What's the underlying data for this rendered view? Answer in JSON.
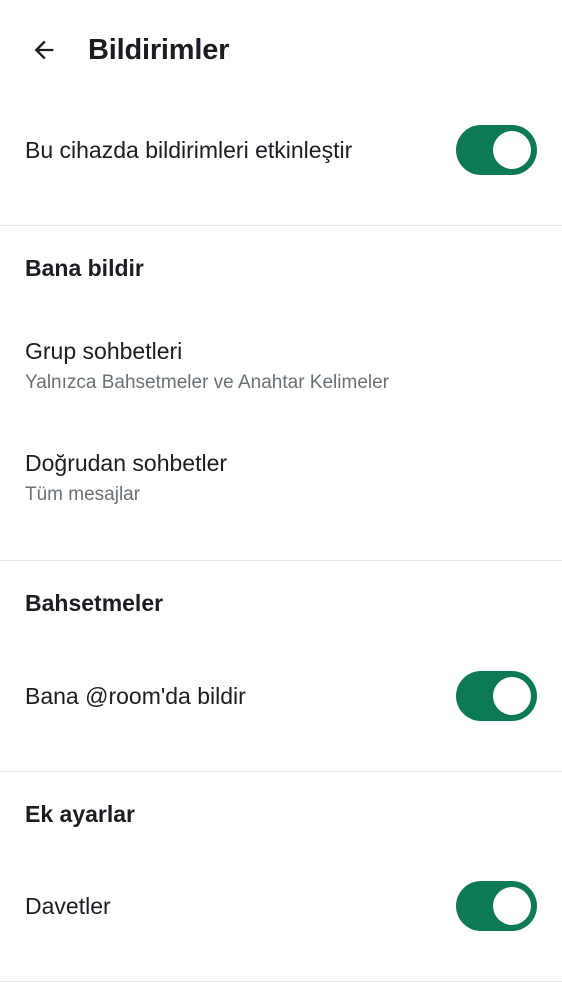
{
  "header": {
    "back_icon": "arrow-left-icon",
    "title": "Bildirimler"
  },
  "device_notifications": {
    "label": "Bu cihazda bildirimleri etkinleştir",
    "enabled": true
  },
  "notify_me": {
    "section_title": "Bana bildir",
    "group_chats": {
      "label": "Grup sohbetleri",
      "value": "Yalnızca Bahsetmeler ve Anahtar Kelimeler"
    },
    "direct_chats": {
      "label": "Doğrudan sohbetler",
      "value": "Tüm mesajlar"
    }
  },
  "mentions": {
    "section_title": "Bahsetmeler",
    "room_mention": {
      "label": "Bana @room'da bildir",
      "enabled": true
    }
  },
  "additional": {
    "section_title": "Ek ayarlar",
    "invites": {
      "label": "Davetler",
      "enabled": true
    }
  },
  "colors": {
    "accent": "#0d7a55",
    "text_primary": "#1b1d22",
    "text_secondary": "#6b6f78",
    "divider": "#e6e7ea"
  }
}
